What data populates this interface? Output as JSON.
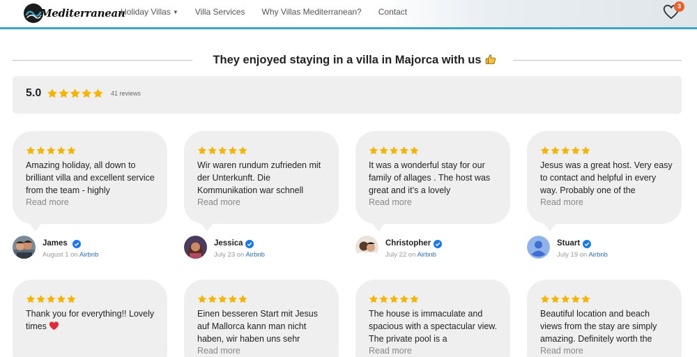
{
  "header": {
    "logo_text": "Mediterranean",
    "nav": [
      {
        "label": "Holiday Villas",
        "has_dropdown": true
      },
      {
        "label": "Villa Services",
        "has_dropdown": false
      },
      {
        "label": "Why Villas Mediterranean?",
        "has_dropdown": false
      },
      {
        "label": "Contact",
        "has_dropdown": false
      }
    ],
    "favorites_count": "3"
  },
  "section": {
    "title": "They enjoyed staying in a villa in Majorca with us"
  },
  "summary": {
    "score": "5.0",
    "stars": 5,
    "reviews_label": "41  reviews"
  },
  "reviews": [
    {
      "stars": 5,
      "text": "Amazing holiday, all down to brilliant villa and excellent service from the team - highly",
      "read_more": "Read more",
      "name": "James",
      "date": "August 1",
      "on": "on",
      "source": "Airbnb"
    },
    {
      "stars": 5,
      "text": "Wir waren rundum zufrieden mit der Unterkunft. Die Kommunikation war schnell",
      "read_more": "Read more",
      "name": "Jessica",
      "date": "July 23",
      "on": "on",
      "source": "Airbnb"
    },
    {
      "stars": 5,
      "text": "It was a wonderful stay for our family of allages . The host was great and it’s a lovely",
      "read_more": "Read more",
      "name": "Christopher",
      "date": "July 22",
      "on": "on",
      "source": "Airbnb"
    },
    {
      "stars": 5,
      "text": "Jesus was a great host. Very easy to contact and helpful in every way. Probably one of the",
      "read_more": "Read more",
      "name": "Stuart",
      "date": "July 19",
      "on": "on",
      "source": "Airbnb"
    },
    {
      "stars": 5,
      "text": "Thank you for everything!! Lovely times",
      "has_heart": true,
      "read_more": ""
    },
    {
      "stars": 5,
      "text": "Einen besseren Start mit Jesus auf Mallorca kann man nicht haben, wir haben uns sehr",
      "read_more": "Read more"
    },
    {
      "stars": 5,
      "text": "The house is immaculate and spacious with a spectacular view. The private pool is a",
      "read_more": "Read more"
    },
    {
      "stars": 5,
      "text": "Beautiful location and beach views from the stay are simply amazing. Definitely worth the",
      "read_more": "Read more"
    }
  ],
  "colors": {
    "star": "#f5b400",
    "accent": "#3aa6c9",
    "verified": "#1877f2",
    "link": "#2b6fb5",
    "badge": "#e8612c",
    "card_bg": "#efefef"
  }
}
